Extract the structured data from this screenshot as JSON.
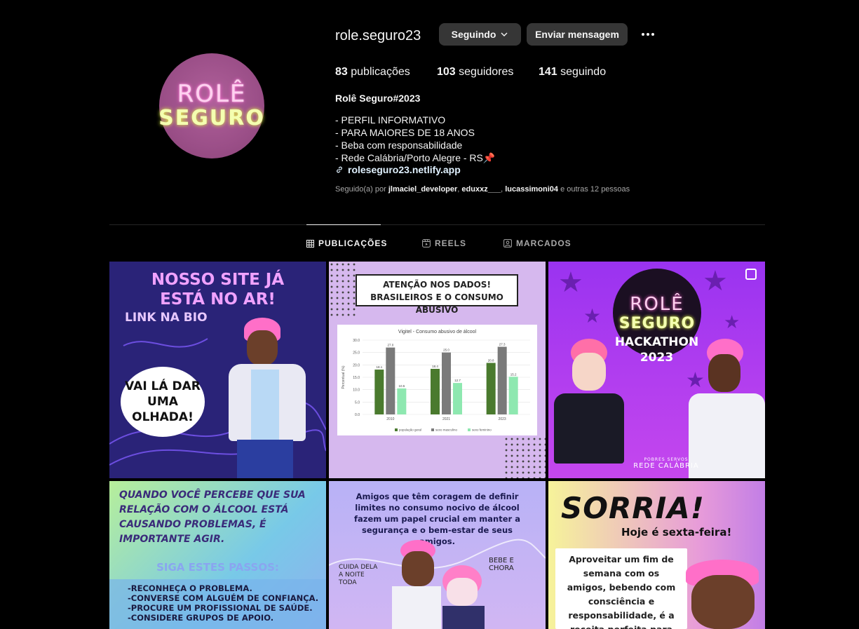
{
  "profile": {
    "username": "role.seguro23",
    "avatar_text_top": "ROLÊ",
    "avatar_text_bottom": "SEGURO",
    "following_button": "Seguindo",
    "message_button": "Enviar mensagem"
  },
  "stats": {
    "posts_count": "83",
    "posts_label": "publicações",
    "followers_count": "103",
    "followers_label": "seguidores",
    "following_count": "141",
    "following_label": "seguindo"
  },
  "bio": {
    "name": "Rolê Seguro#2023",
    "lines": [
      "- PERFIL INFORMATIVO",
      "- PARA MAIORES DE 18 ANOS",
      "- Beba com responsabilidade",
      "- Rede Calábria/Porto Alegre - RS📌"
    ],
    "link": "roleseguro23.netlify.app",
    "followed_by_prefix": "Seguido(a) por",
    "followed_by_users": [
      "jlmaciel_developer",
      "eduxxz___",
      "lucassimoni04"
    ],
    "followed_by_suffix": "e outras 12 pessoas"
  },
  "tabs": [
    {
      "label": "PUBLICAÇÕES",
      "icon": "grid-icon",
      "active": true
    },
    {
      "label": "REELS",
      "icon": "reels-icon",
      "active": false
    },
    {
      "label": "MARCADOS",
      "icon": "tagged-icon",
      "active": false
    }
  ],
  "posts": {
    "p1": {
      "headline": "NOSSO SITE JÁ ESTÁ NO AR!",
      "sub": "LINK NA BIO",
      "bubble": "VAI LÁ DAR UMA OLHADA!"
    },
    "p2": {
      "banner_line1": "ATENÇÃO NOS DADOS!",
      "banner_line2": "BRASILEIROS E O CONSUMO ABUSIVO",
      "chart_title": "Vigitel - Consumo abusivo de álcool",
      "ylabel": "Percentual (%)",
      "legend": [
        "população geral",
        "sexo masculino",
        "sexo feminino"
      ]
    },
    "p3": {
      "logo_top": "ROLÊ",
      "logo_bottom": "SEGURO",
      "title_line1": "HACKATHON",
      "title_line2": "2023",
      "org_small": "POBRES SERVOS",
      "org": "REDE CALÁBRIA"
    },
    "p4": {
      "intro": "QUANDO VOCÊ PERCEBE QUE SUA RELAÇÃO COM O ÁLCOOL ESTÁ CAUSANDO PROBLEMAS, É IMPORTANTE AGIR.",
      "steps_title": "SIGA ESTES PASSOS:",
      "steps": [
        "-RECONHEÇA O PROBLEMA.",
        "-CONVERSE COM ALGUÉM DE CONFIANÇA.",
        "-PROCURE UM PROFISSIONAL DE SAÚDE.",
        "-CONSIDERE GRUPOS DE APOIO."
      ]
    },
    "p5": {
      "text": "Amigos que têm coragem de definir limites no consumo nocivo de álcool fazem um papel crucial em manter a segurança e o bem-estar de seus amigos.",
      "note_left": "CUIDA DELA A NOITE TODA",
      "note_right": "BEBE E CHORA"
    },
    "p6": {
      "big": "SORRIA!",
      "sub": "Hoje é sexta-feira!",
      "card": "Aproveitar um fim de semana com os amigos, bebendo com consciência e responsabilidade, é a receita perfeita para criar memórias incríveis"
    }
  },
  "chart_data": {
    "type": "bar",
    "title": "Vigitel - Consumo abusivo de álcool",
    "ylabel": "Percentual (%)",
    "categories": [
      "2010",
      "2021",
      "2023"
    ],
    "ylim": [
      0,
      30
    ],
    "yticks": [
      "0.0",
      "5.0",
      "10.0",
      "15.0",
      "20.0",
      "25.0",
      "30.0"
    ],
    "series": [
      {
        "name": "população geral",
        "values": [
          18.1,
          18.4,
          20.8
        ],
        "color": "#4a7a2e"
      },
      {
        "name": "sexo masculino",
        "values": [
          27.0,
          25.0,
          27.3
        ],
        "color": "#7a7a7a"
      },
      {
        "name": "sexo feminino",
        "values": [
          10.5,
          12.7,
          15.2
        ],
        "color": "#8ee8b0"
      }
    ]
  },
  "colors": {
    "background": "#000000",
    "button": "#363636",
    "link": "#e0f1ff",
    "muted": "#a8a8a8"
  }
}
